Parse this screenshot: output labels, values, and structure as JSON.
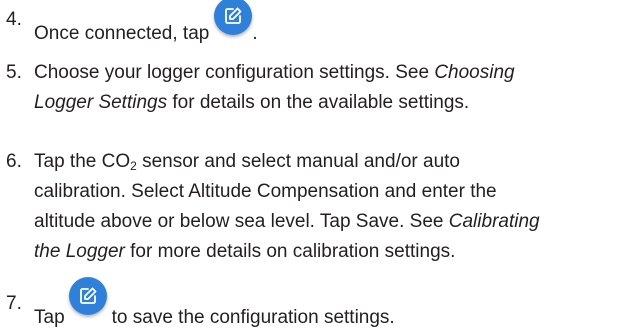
{
  "steps": [
    {
      "number": "4.",
      "text_before_icon": "Once connected, tap",
      "icon": "edit-icon",
      "text_after_icon": "."
    },
    {
      "number": "5.",
      "line1": "Choose your logger configuration settings. See",
      "line1_italic": "Choosing",
      "line2_italic": "Logger Settings",
      "line2": " for details on the available settings."
    },
    {
      "number": "6.",
      "line1_a": "Tap the CO",
      "line1_sub": "2",
      "line1_b": " sensor and select manual and/or auto",
      "line2": "calibration. Select Altitude Compensation and enter the",
      "line3_a": "altitude above or below sea level. Tap Save. See ",
      "line3_italic": "Calibrating",
      "line4_italic": "the Logger",
      "line4": " for more details on calibration settings."
    },
    {
      "number": "7.",
      "text_before_icon": "Tap",
      "icon": "edit-icon",
      "text_after_icon": "to save the configuration settings."
    }
  ],
  "colors": {
    "text": "#231f20",
    "icon_background": "#2f80d9",
    "icon_glyph": "#ffffff"
  }
}
